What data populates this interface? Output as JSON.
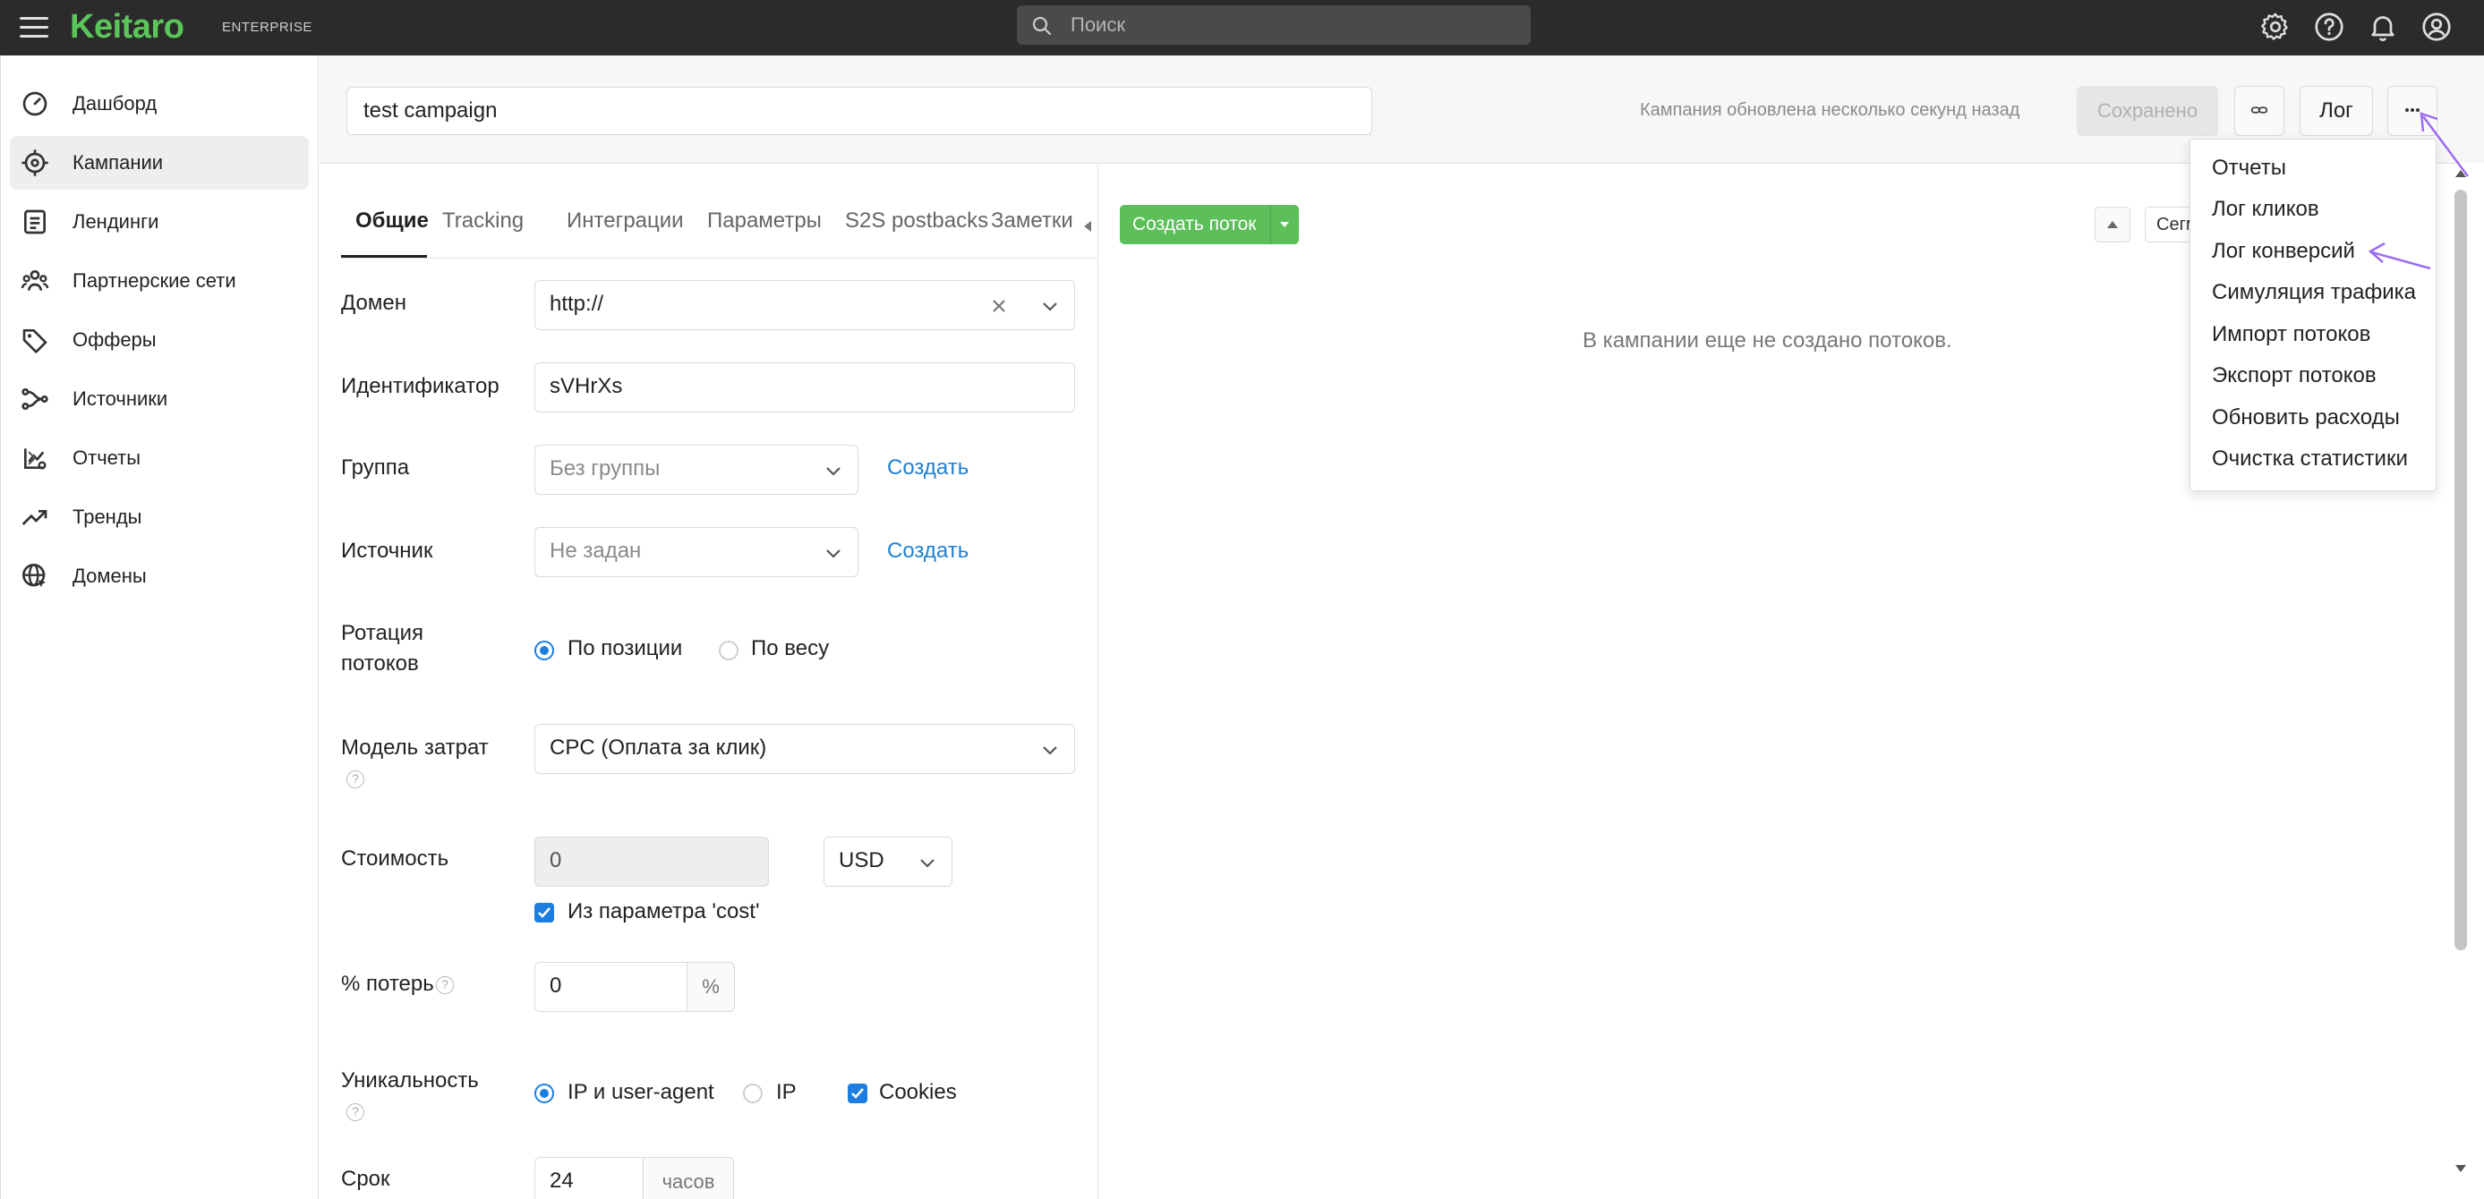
{
  "topbar": {
    "logo": "Keitaro",
    "logo_sub": "ENTERPRISE",
    "search_placeholder": "Поиск"
  },
  "sidebar": {
    "items": [
      {
        "label": "Дашборд",
        "icon": "dashboard-icon"
      },
      {
        "label": "Кампании",
        "icon": "target-icon"
      },
      {
        "label": "Лендинги",
        "icon": "landing-icon"
      },
      {
        "label": "Партнерские сети",
        "icon": "users-icon"
      },
      {
        "label": "Офферы",
        "icon": "tag-icon"
      },
      {
        "label": "Источники",
        "icon": "source-icon"
      },
      {
        "label": "Отчеты",
        "icon": "report-icon"
      },
      {
        "label": "Тренды",
        "icon": "trend-icon"
      },
      {
        "label": "Домены",
        "icon": "globe-icon"
      }
    ]
  },
  "header": {
    "campaign_name": "test campaign",
    "updated_text": "Кампания обновлена несколько секунд назад",
    "saved_label": "Сохранено",
    "log_label": "Лог"
  },
  "tabs": [
    "Общие",
    "Tracking",
    "Интеграции",
    "Параметры",
    "S2S postbacks",
    "Заметки"
  ],
  "form": {
    "domain_label": "Домен",
    "domain_value": "http://",
    "identifier_label": "Идентификатор",
    "identifier_value": "sVHrXs",
    "group_label": "Группа",
    "group_value": "Без группы",
    "source_label": "Источник",
    "source_value": "Не задан",
    "create_label": "Создать",
    "rotation_label_1": "Ротация",
    "rotation_label_2": "потоков",
    "rotation_opt_position": "По позиции",
    "rotation_opt_weight": "По весу",
    "cost_model_label": "Модель затрат",
    "cost_model_value": "CPC (Оплата за клик)",
    "cost_label": "Стоимость",
    "cost_value": "0",
    "currency_value": "USD",
    "cost_param_label": "Из параметра 'cost'",
    "loss_label": "% потерь",
    "loss_value": "0",
    "loss_suffix": "%",
    "uniq_label": "Уникальность",
    "uniq_opt_ip_ua": "IP и user-agent",
    "uniq_opt_ip": "IP",
    "uniq_opt_cookies": "Cookies",
    "term_label": "Срок",
    "term_value": "24",
    "term_suffix": "часов"
  },
  "streams": {
    "create_label": "Создать поток",
    "segment_label": "Сегм",
    "empty_message": "В кампании еще не создано потоков."
  },
  "menu": {
    "items": [
      "Отчеты",
      "Лог кликов",
      "Лог конверсий",
      "Симуляция трафика",
      "Импорт потоков",
      "Экспорт потоков",
      "Обновить расходы",
      "Очистка статистики"
    ]
  },
  "colors": {
    "accent_green": "#5cbf5a",
    "link_blue": "#1f7fd1",
    "annotation_arrow": "#9b6cf0"
  }
}
